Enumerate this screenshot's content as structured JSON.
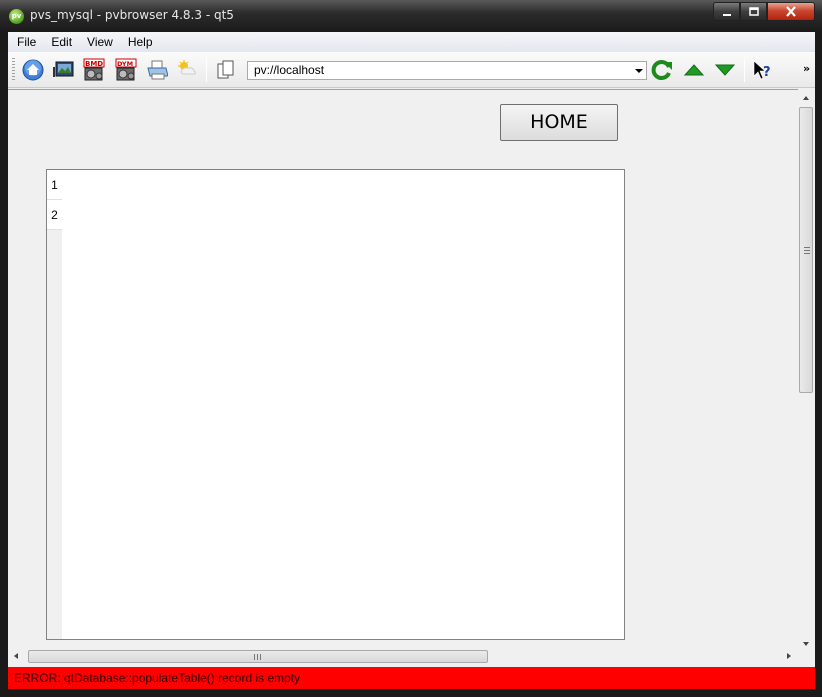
{
  "window": {
    "title": "pvs_mysql - pvbrowser 4.8.3 - qt5",
    "app_icon_text": "pv",
    "controls": {
      "minimize": "▁",
      "maximize": "□",
      "close": "✕"
    }
  },
  "menu": {
    "items": [
      "File",
      "Edit",
      "View",
      "Help"
    ]
  },
  "toolbar": {
    "url_value": "pv://localhost",
    "overflow": "»",
    "icons": [
      "home-icon",
      "screenshot-icon",
      "server-icon",
      "dynamic-server-icon",
      "print-icon",
      "sun-icon",
      "copy-icon",
      "reload-icon",
      "arrow-up-icon",
      "arrow-down-icon",
      "whats-this-icon"
    ]
  },
  "content": {
    "home_button_label": "HOME",
    "table": {
      "row_headers": [
        "1",
        "2"
      ]
    }
  },
  "scrollbars": {
    "h_grip": "|||",
    "v_grip": "≡"
  },
  "status": {
    "message": "ERROR: qtDatabase::populateTable() record is empty"
  },
  "colors": {
    "status_error": "#ff0000",
    "content_bg": "#f0f0f0"
  }
}
